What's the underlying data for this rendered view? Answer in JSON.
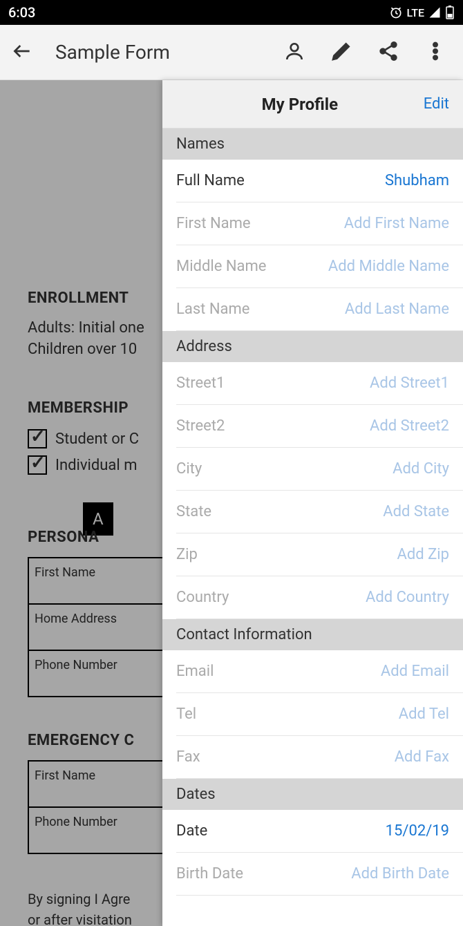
{
  "statusbar": {
    "time": "6:03",
    "network": "LTE"
  },
  "appbar": {
    "title": "Sample Form"
  },
  "bgform": {
    "enrollment_head": "ENROLLMENT",
    "enrollment_line1": "Adults: Initial one",
    "enrollment_line2": "Children over 10",
    "membership_head": "MEMBERSHIP",
    "student_label": "Student or C",
    "individual_label": "Individual m",
    "blackbox": "A",
    "personal_head": "PERSONA",
    "first_name": "First Name",
    "home_address": "Home Address",
    "phone_number": "Phone Number",
    "emergency_head": "EMERGENCY C",
    "agree_text": "By signing I Agre",
    "agree_text2": "or after visitation"
  },
  "panel": {
    "title": "My Profile",
    "edit": "Edit",
    "sections": {
      "names": {
        "head": "Names",
        "fields": [
          {
            "label": "Full Name",
            "value": "Shubham",
            "filled": true
          },
          {
            "label": "First Name",
            "placeholder": "Add First Name"
          },
          {
            "label": "Middle Name",
            "placeholder": "Add Middle Name"
          },
          {
            "label": "Last Name",
            "placeholder": "Add Last Name"
          }
        ]
      },
      "address": {
        "head": "Address",
        "fields": [
          {
            "label": "Street1",
            "placeholder": "Add Street1"
          },
          {
            "label": "Street2",
            "placeholder": "Add Street2"
          },
          {
            "label": "City",
            "placeholder": "Add City"
          },
          {
            "label": "State",
            "placeholder": "Add State"
          },
          {
            "label": "Zip",
            "placeholder": "Add Zip"
          },
          {
            "label": "Country",
            "placeholder": "Add Country"
          }
        ]
      },
      "contact": {
        "head": "Contact Information",
        "fields": [
          {
            "label": "Email",
            "placeholder": "Add Email"
          },
          {
            "label": "Tel",
            "placeholder": "Add Tel"
          },
          {
            "label": "Fax",
            "placeholder": "Add Fax"
          }
        ]
      },
      "dates": {
        "head": "Dates",
        "fields": [
          {
            "label": "Date",
            "value": "15/02/19",
            "filled": true
          },
          {
            "label": "Birth Date",
            "placeholder": "Add Birth Date"
          }
        ]
      }
    }
  }
}
